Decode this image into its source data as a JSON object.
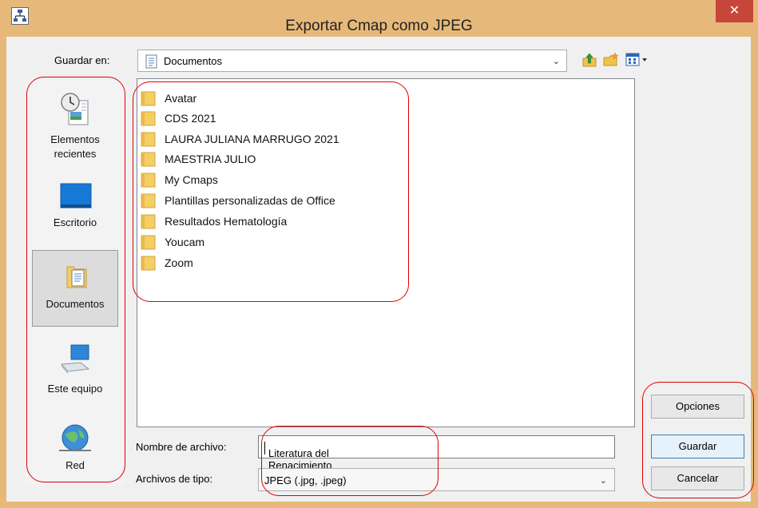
{
  "window": {
    "title": "Exportar Cmap como JPEG",
    "close_glyph": "✕",
    "accent_color": "#e6b97a",
    "close_color": "#c7463a"
  },
  "save_in": {
    "label": "Guardar en:",
    "value": "Documentos",
    "icon": "document-folder-icon"
  },
  "toolbar": {
    "icons": [
      "up-folder-icon",
      "new-folder-icon",
      "view-menu-icon"
    ]
  },
  "places": [
    {
      "label": "Elementos recientes",
      "icon": "recent-items-icon"
    },
    {
      "label": "Escritorio",
      "icon": "desktop-icon"
    },
    {
      "label": "Documentos",
      "icon": "documents-icon",
      "selected": true
    },
    {
      "label": "Este equipo",
      "icon": "computer-icon"
    },
    {
      "label": "Red",
      "icon": "network-icon"
    }
  ],
  "files": [
    {
      "name": "Avatar"
    },
    {
      "name": "CDS 2021"
    },
    {
      "name": "LAURA JULIANA MARRUGO 2021"
    },
    {
      "name": "MAESTRIA JULIO"
    },
    {
      "name": "My Cmaps"
    },
    {
      "name": "Plantillas personalizadas de Office"
    },
    {
      "name": "Resultados Hematología"
    },
    {
      "name": "Youcam"
    },
    {
      "name": "Zoom"
    }
  ],
  "filename": {
    "label": "Nombre de archivo:",
    "value": "Literatura del Renacimiento"
  },
  "filetype": {
    "label": "Archivos de tipo:",
    "value": "JPEG (.jpg, .jpeg)"
  },
  "buttons": {
    "options": "Opciones",
    "save": "Guardar",
    "cancel": "Cancelar"
  },
  "annotation_color": "#e00000"
}
